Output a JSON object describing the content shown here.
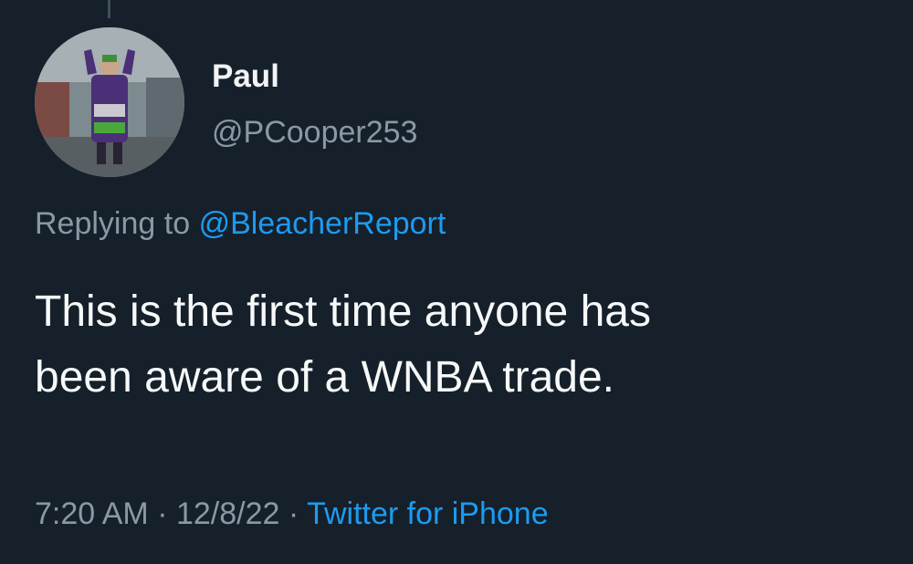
{
  "author": {
    "display_name": "Paul",
    "handle": "@PCooper253"
  },
  "reply": {
    "prefix": "Replying to",
    "mention": "@BleacherReport"
  },
  "tweet": {
    "text": "This is the first time anyone has\nbeen aware of a WNBA trade."
  },
  "meta": {
    "time": "7:20 AM",
    "separator": "·",
    "date": "12/8/22",
    "source": "Twitter for iPhone"
  },
  "colors": {
    "background": "#15202b",
    "text": "#f7f9f9",
    "secondary": "#8b98a5",
    "accent": "#1d9bf0"
  }
}
